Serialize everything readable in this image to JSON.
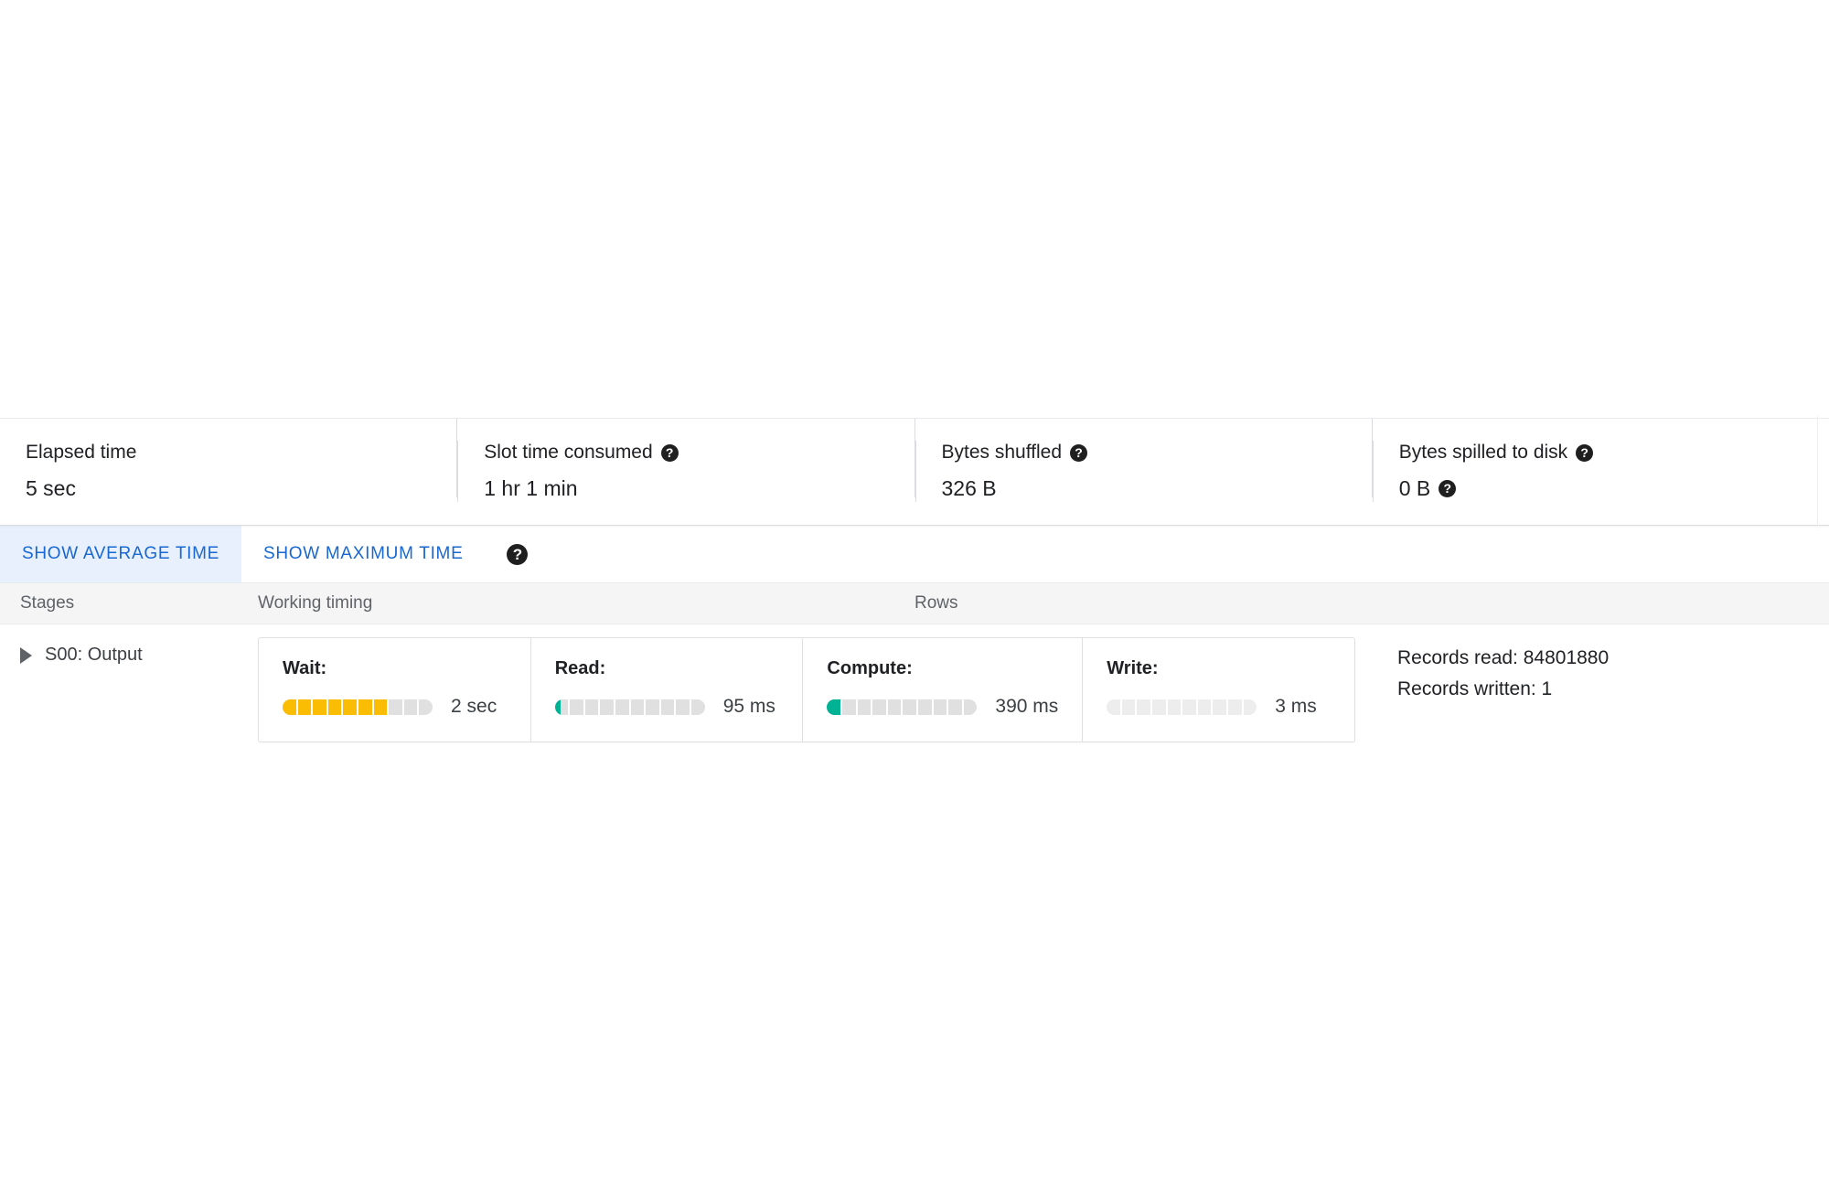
{
  "stats": [
    {
      "label": "Elapsed time",
      "value": "5 sec",
      "has_label_help": false,
      "has_value_help": false
    },
    {
      "label": "Slot time consumed",
      "value": "1 hr 1 min",
      "has_label_help": true,
      "has_value_help": false
    },
    {
      "label": "Bytes shuffled",
      "value": "326 B",
      "has_label_help": true,
      "has_value_help": false
    },
    {
      "label": "Bytes spilled to disk",
      "value": "0 B",
      "has_label_help": true,
      "has_value_help": true
    }
  ],
  "tabs": [
    {
      "label": "SHOW AVERAGE TIME",
      "selected": true
    },
    {
      "label": "SHOW MAXIMUM TIME",
      "selected": false
    }
  ],
  "tabs_help_icon": "help-icon",
  "table": {
    "headers": {
      "stages": "Stages",
      "timing": "Working timing",
      "rows": "Rows"
    },
    "row": {
      "stage_name": "S00: Output",
      "expander_icon": "triangle-right-icon",
      "phases": [
        {
          "label": "Wait:",
          "value": "2 sec",
          "segments": 10,
          "filled": 7,
          "partial": 0,
          "color": "#fbbc04"
        },
        {
          "label": "Read:",
          "value": "95 ms",
          "segments": 10,
          "filled": 0,
          "partial": 0.45,
          "color": "#00b294"
        },
        {
          "label": "Compute:",
          "value": "390 ms",
          "segments": 10,
          "filled": 1,
          "partial": 0,
          "color": "#00b294"
        },
        {
          "label": "Write:",
          "value": "3 ms",
          "segments": 10,
          "filled": 0,
          "partial": 0,
          "color": "#00b294"
        }
      ],
      "rows_info": [
        "Records read: 84801880",
        "Records written: 1"
      ]
    }
  },
  "colors": {
    "accent_blue": "#1967d2",
    "tab_selected_bg": "#e8f0fe",
    "amber": "#fbbc04",
    "teal": "#00b294",
    "track_gray": "#e0e0e0",
    "header_bg": "#f5f5f5"
  }
}
